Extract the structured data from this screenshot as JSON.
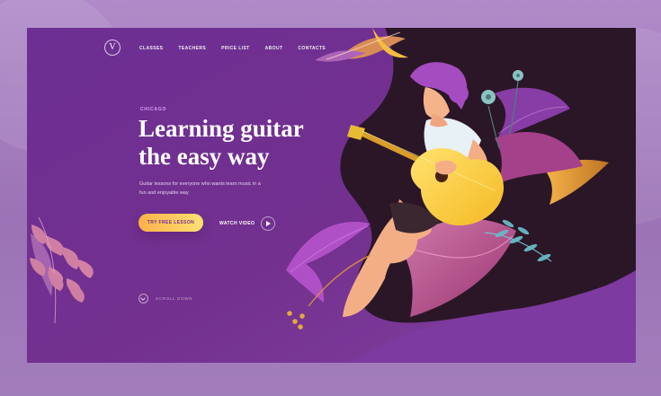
{
  "nav": {
    "logo_letter": "V",
    "items": [
      "CLASSES",
      "TEACHERS",
      "PRICE LIST",
      "ABOUT",
      "CONTACTS"
    ]
  },
  "hero": {
    "location": "CHICAGO",
    "title": "Learning guitar the easy way",
    "subtitle": "Guitar lessons for everyone who wants learn music in a fun and enjoyable way",
    "primary_button": "TRY FREE LESSON",
    "secondary_button": "WATCH VIDEO",
    "scroll_label": "SCROLL DOWN"
  },
  "icons": {
    "logo": "v-logo-icon",
    "play": "play-icon",
    "scroll": "chevron-down-icon",
    "decorative": [
      "leaf-icon",
      "guitar-icon",
      "flower-icon",
      "player-figure-icon"
    ]
  },
  "colors": {
    "page": "#a07ab8",
    "card": "#6d2f93",
    "dark_shape": "#2b1628",
    "accent_yellow": "#ffcf3f",
    "accent_orange": "#f0a031",
    "purple_leaf": "#a44cc0",
    "pink_leaf": "#c74f88"
  }
}
